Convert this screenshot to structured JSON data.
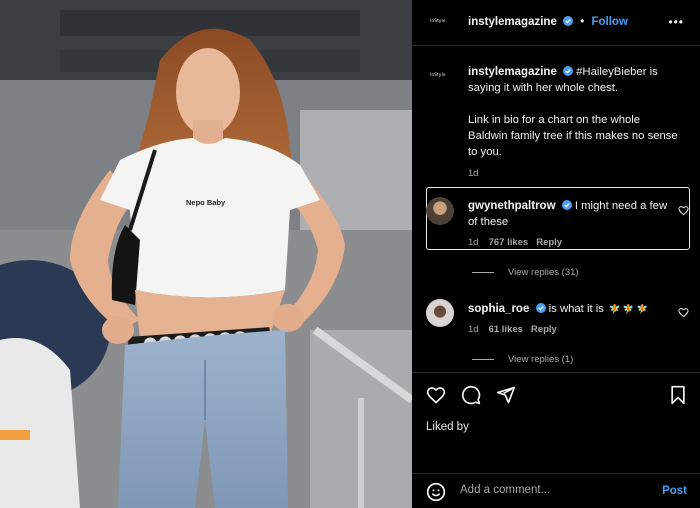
{
  "account": {
    "logo_text": "InStyle",
    "username": "instylemagazine",
    "follow_label": "Follow",
    "more_label": "•••"
  },
  "photo": {
    "shirt_text": "Nepo Baby"
  },
  "caption": {
    "username": "instylemagazine",
    "line1": "#HaileyBieber is saying it with her whole chest.",
    "line2": "Link in bio for a chart on the whole Baldwin family tree if this makes no sense to you.",
    "time": "1d"
  },
  "comments": [
    {
      "username": "gwynethpaltrow",
      "text": "I might need a few of these",
      "time": "1d",
      "likes": "767 likes",
      "reply": "Reply",
      "view_replies": "View replies (31)"
    },
    {
      "username": "sophia_roe",
      "text": "is what it is",
      "emoji": "🧚 🧚 🧚",
      "time": "1d",
      "likes": "61 likes",
      "reply": "Reply",
      "view_replies": "View replies (1)"
    }
  ],
  "actions": {
    "liked_by": "Liked by"
  },
  "composer": {
    "placeholder": "Add a comment...",
    "post_label": "Post"
  },
  "colors": {
    "accent": "#4a9df0",
    "background": "#000000",
    "muted": "#a8a8a8"
  }
}
